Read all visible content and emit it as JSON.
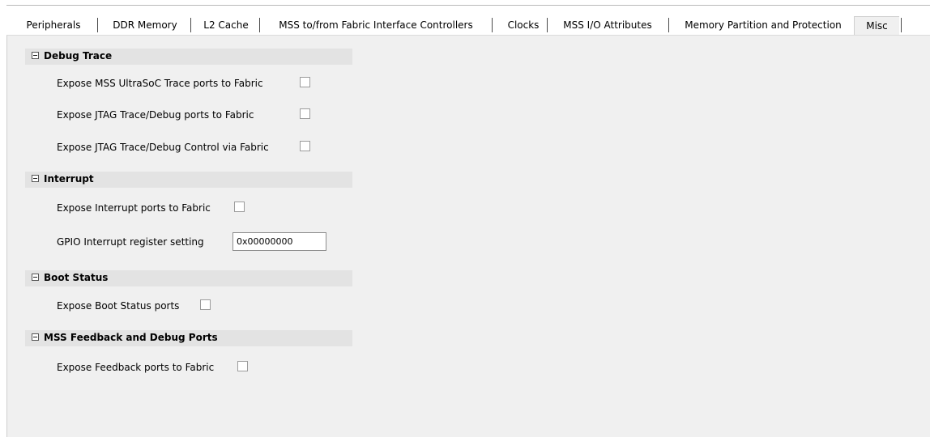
{
  "tabs": [
    {
      "label": "Peripherals",
      "active": false
    },
    {
      "label": "DDR Memory",
      "active": false
    },
    {
      "label": "L2 Cache",
      "active": false
    },
    {
      "label": "MSS to/from Fabric Interface Controllers",
      "active": false
    },
    {
      "label": "Clocks",
      "active": false
    },
    {
      "label": "MSS I/O Attributes",
      "active": false
    },
    {
      "label": "Memory Partition and Protection",
      "active": false
    },
    {
      "label": "Misc",
      "active": true
    }
  ],
  "sections": {
    "debug_trace": {
      "title": "Debug Trace",
      "rows": [
        {
          "label": "Expose MSS UltraSoC Trace ports to Fabric",
          "checked": false
        },
        {
          "label": "Expose JTAG Trace/Debug ports to Fabric",
          "checked": false
        },
        {
          "label": "Expose JTAG Trace/Debug Control via Fabric",
          "checked": false
        }
      ]
    },
    "interrupt": {
      "title": "Interrupt",
      "expose_label": "Expose Interrupt ports to Fabric",
      "expose_checked": false,
      "gpio_label": "GPIO Interrupt register setting",
      "gpio_value": "0x00000000"
    },
    "boot_status": {
      "title": "Boot Status",
      "expose_label": "Expose Boot Status ports",
      "expose_checked": false
    },
    "feedback": {
      "title": "MSS Feedback and Debug Ports",
      "expose_label": "Expose Feedback ports to Fabric",
      "expose_checked": false
    }
  }
}
